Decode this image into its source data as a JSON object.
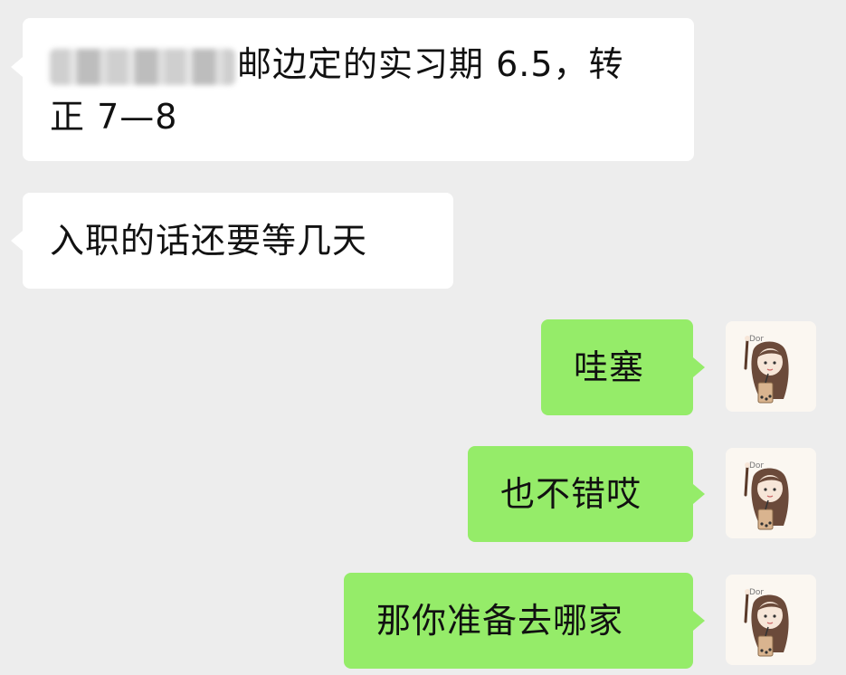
{
  "messages": [
    {
      "side": "left",
      "line1": "邮边定的实习期 6.5，转",
      "line2": "正 7—8"
    },
    {
      "side": "left",
      "text": "入职的话还要等几天"
    },
    {
      "side": "right",
      "text": "哇塞"
    },
    {
      "side": "right",
      "text": "也不错哎"
    },
    {
      "side": "right",
      "text": "那你准备去哪家"
    }
  ],
  "avatar": {
    "icon": "girl-holding-bubble-tea-icon",
    "caption": "Dor"
  },
  "colors": {
    "background": "#ededed",
    "incoming": "#ffffff",
    "outgoing": "#95ec69"
  }
}
